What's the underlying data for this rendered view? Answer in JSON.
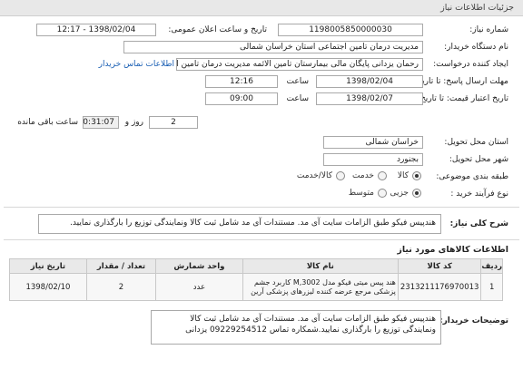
{
  "header": {
    "title": "جزئیات اطلاعات نیاز"
  },
  "form": {
    "need_number_label": "شماره نیاز:",
    "need_number": "1198005850000030",
    "announce_label": "تاریخ و ساعت اعلان عمومی:",
    "announce_value": "1398/02/04 - 12:17",
    "buyer_org_label": "نام دستگاه خریدار:",
    "buyer_org": "مدیریت درمان تامین اجتماعی استان خراسان شمالی",
    "creator_label": "ایجاد کننده درخواست:",
    "creator": "رحمان یزدانی پایگان مالی بیمارستان تامین الائمه مدیریت درمان تامین اجتماعی ا",
    "contact_link": "اطلاعات تماس خریدار",
    "send_deadline_label": "مهلت ارسال پاسخ: تا تاریخ:",
    "send_deadline_date": "1398/02/04",
    "time_word": "ساعت",
    "send_deadline_time": "12:16",
    "days_word": "روز و",
    "days_value": "2",
    "remaining_time": "20:31:07",
    "remaining_label": "ساعت باقی مانده",
    "price_validity_label": "تاریخ اعتبار قیمت: تا تاریخ:",
    "price_validity_date": "1398/02/07",
    "price_validity_time": "09:00",
    "province_label": "استان محل تحویل:",
    "province": "خراسان شمالی",
    "city_label": "شهر محل تحویل:",
    "city": "بجنورد",
    "category_label": "طبقه بندی موضوعی:",
    "category_options": [
      "کالا",
      "خدمت",
      "کالا/خدمت"
    ],
    "purchase_type_label": "نوع فرآیند خرید :",
    "purchase_type_options": [
      "جزیی",
      "متوسط"
    ],
    "general_desc_label": "شرح کلی نیاز:",
    "general_desc": "هندپیس فیکو طبق الزامات سایت آی مد. مستندات آی مد شامل ثبت کالا ونمایندگی توزیع را بارگذاری نمایید."
  },
  "items_section": {
    "title": "اطلاعات کالاهای مورد نیاز",
    "columns": [
      "ردیف",
      "کد کالا",
      "نام کالا",
      "واحد شمارش",
      "تعداد / مقدار",
      "تاریخ نیاز"
    ],
    "rows": [
      {
        "index": "1",
        "code": "2313211176970013",
        "name": "هند پیس میتی فیکو مدل M,3002 کاربرد جشم پزشکی مرجع عرضه کننده لیزرهای پزشکی آرین",
        "unit": "عدد",
        "qty": "2",
        "date": "1398/02/10"
      }
    ]
  },
  "buyer_desc": {
    "label": "توضیحات خریدار:",
    "text": "هندپیس فیکو طبق الزامات سایت آی مد. مستندات آی مد شامل ثبت کالا ونمایندگی توزیع را بارگذاری نمایید.شمکاره تماس 09229254512 یزدانی"
  }
}
